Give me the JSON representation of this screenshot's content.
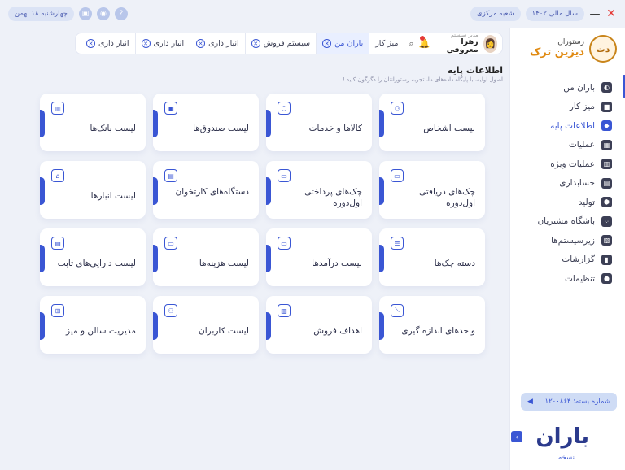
{
  "window": {
    "date": "چهارشنبه ۱۸ بهمن",
    "fiscal_year": "سال مالی ۱۴۰۲",
    "branch": "شعبه مرکزی"
  },
  "brand": {
    "small": "رستوران",
    "name": "دیزین ترک"
  },
  "user": {
    "role": "مدیر سیستم",
    "name": "زهرا معروفی"
  },
  "tabs": [
    {
      "label": "میز کار",
      "active": false,
      "closable": false
    },
    {
      "label": "باران من",
      "active": true,
      "closable": true
    },
    {
      "label": "سیستم فروش",
      "active": false,
      "closable": true
    },
    {
      "label": "انبار داری",
      "active": false,
      "closable": true
    },
    {
      "label": "انبار داری",
      "active": false,
      "closable": true
    },
    {
      "label": "انبار داری",
      "active": false,
      "closable": true
    }
  ],
  "sidebar": {
    "items": [
      {
        "label": "باران من",
        "icon": "baran-icon"
      },
      {
        "label": "میز کار",
        "icon": "desk-icon"
      },
      {
        "label": "اطلاعات پایه",
        "icon": "base-info-icon"
      },
      {
        "label": "عملیات",
        "icon": "operations-icon"
      },
      {
        "label": "عملیات ویژه",
        "icon": "special-operations-icon"
      },
      {
        "label": "حسابداری",
        "icon": "accounting-icon"
      },
      {
        "label": "تولید",
        "icon": "production-icon"
      },
      {
        "label": "باشگاه مشتریان",
        "icon": "customers-club-icon"
      },
      {
        "label": "زیرسیستم‌ها",
        "icon": "subsystems-icon"
      },
      {
        "label": "گزارشات",
        "icon": "reports-icon"
      },
      {
        "label": "تنظیمات",
        "icon": "settings-icon"
      }
    ],
    "active_index": 2,
    "branch_number": "شماره بسته: ۱۲۰۰۸۶۴",
    "logo_text": "باران",
    "version": "نسخه"
  },
  "page": {
    "title": "اطلاعات پایه",
    "subtitle": "اصول اولیه، با پایگاه داده‌های ما، تجربه رستورانتان را دگرگون کنید !"
  },
  "cards": [
    {
      "label": "لیست اشخاص",
      "icon": "people-icon"
    },
    {
      "label": "کالاها و خدمات",
      "icon": "box-icon"
    },
    {
      "label": "لیست صندوق‌ها",
      "icon": "cashbox-icon"
    },
    {
      "label": "لیست بانک‌ها",
      "icon": "bank-icon"
    },
    {
      "label": "چک‌های دریافتی اول‌دوره",
      "icon": "received-cheque-icon"
    },
    {
      "label": "چک‌های پرداختی اول‌دوره",
      "icon": "paid-cheque-icon"
    },
    {
      "label": "دستگاه‌های کارتخوان",
      "icon": "pos-device-icon"
    },
    {
      "label": "لیست انبارها",
      "icon": "warehouse-icon"
    },
    {
      "label": "دسته چک‌ها",
      "icon": "chequebook-icon"
    },
    {
      "label": "لیست درآمدها",
      "icon": "income-icon"
    },
    {
      "label": "لیست هزینه‌ها",
      "icon": "expense-icon"
    },
    {
      "label": "لیست دارایی‌های ثابت",
      "icon": "fixed-assets-icon"
    },
    {
      "label": "واحدهای اندازه گیری",
      "icon": "ruler-icon"
    },
    {
      "label": "اهداف فروش",
      "icon": "sales-target-icon"
    },
    {
      "label": "لیست کاربران",
      "icon": "users-icon"
    },
    {
      "label": "مدیریت سالن و میز",
      "icon": "hall-table-icon"
    }
  ]
}
